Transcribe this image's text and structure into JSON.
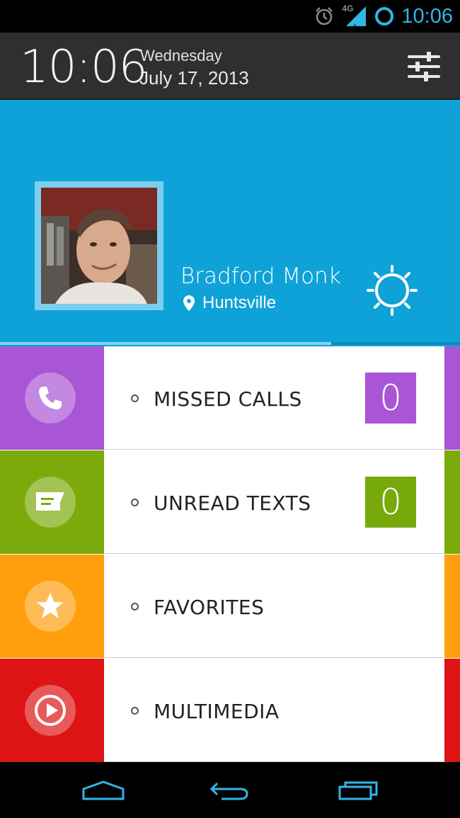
{
  "status_bar": {
    "time": "10:06",
    "network_label": "4G",
    "icons": [
      "alarm-icon",
      "signal-icon",
      "battery-icon"
    ],
    "accent": "#33b5e5"
  },
  "header": {
    "time": "10:06",
    "day": "Wednesday",
    "date": "July 17, 2013",
    "settings_icon": "sliders-icon"
  },
  "profile": {
    "name": "Bradford Monk",
    "location": "Huntsville",
    "background": "#0fa2d8",
    "weather_icon": "sun-icon",
    "progress": 0.72
  },
  "menu": {
    "items": [
      {
        "label": "MISSED CALLS",
        "icon": "phone-icon",
        "color": "#a855d6",
        "count": "0",
        "count_color": "#a855d6"
      },
      {
        "label": "UNREAD TEXTS",
        "icon": "message-icon",
        "color": "#7caa0a",
        "count": "0",
        "count_color": "#77a90a"
      },
      {
        "label": "FAVORITES",
        "icon": "star-icon",
        "color": "#ff9f0d"
      },
      {
        "label": "MULTIMEDIA",
        "icon": "play-icon",
        "color": "#de1414"
      }
    ]
  },
  "nav_bar": {
    "buttons": [
      "home-button",
      "back-button",
      "recents-button"
    ],
    "color": "#33b5e5"
  }
}
